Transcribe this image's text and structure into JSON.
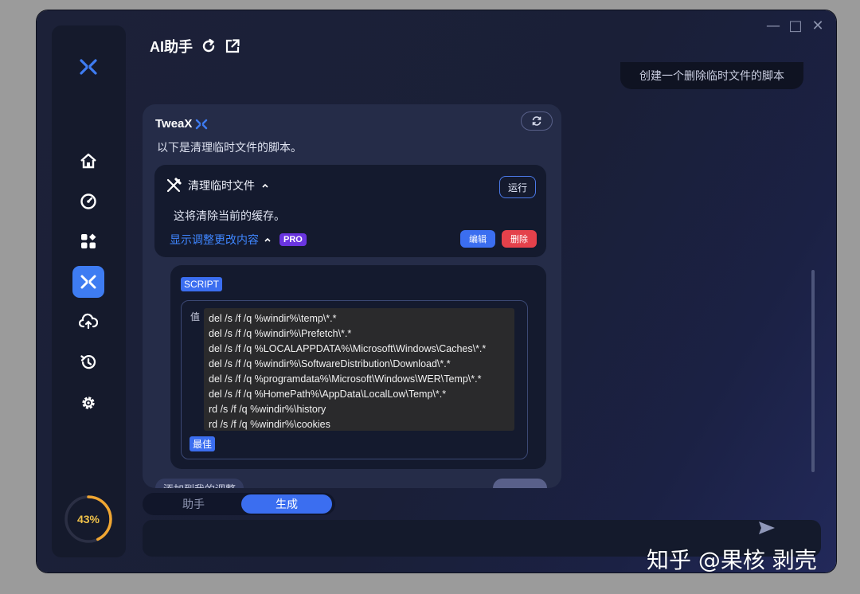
{
  "app": {
    "title": "AI助手",
    "window_controls": [
      "—",
      "□",
      "✕"
    ]
  },
  "sidebar": {
    "logo": "x-logo-icon",
    "items": [
      {
        "name": "home",
        "icon": "home-icon",
        "active": false
      },
      {
        "name": "performance",
        "icon": "gauge-icon",
        "active": false
      },
      {
        "name": "apps",
        "icon": "apps-grid-icon",
        "active": false
      },
      {
        "name": "ai-assistant",
        "icon": "x-logo-icon",
        "active": true
      },
      {
        "name": "cloud-upload",
        "icon": "cloud-upload-icon",
        "active": false
      },
      {
        "name": "history",
        "icon": "history-icon",
        "active": false
      },
      {
        "name": "settings",
        "icon": "gear-icon",
        "active": false
      }
    ],
    "progress": {
      "percent": 43,
      "label": "43%"
    }
  },
  "chat": {
    "user_message": "创建一个删除临时文件的脚本",
    "assistant": {
      "name": "TweaX",
      "intro": "以下是清理临时文件的脚本。",
      "tweak": {
        "title": "清理临时文件",
        "run_label": "运行",
        "description": "这将清除当前的缓存。",
        "show_changes_label": "显示调整更改内容",
        "pro_badge": "PRO",
        "edit_label": "编辑",
        "delete_label": "删除"
      },
      "script": {
        "tag": "SCRIPT",
        "value_label": "值",
        "code": "del /s /f /q %windir%\\temp\\*.*\ndel /s /f /q %windir%\\Prefetch\\*.*\ndel /s /f /q %LOCALAPPDATA%\\Microsoft\\Windows\\Caches\\*.*\ndel /s /f /q %windir%\\SoftwareDistribution\\Download\\*.*\ndel /s /f /q %programdata%\\Microsoft\\Windows\\WER\\Temp\\*.*\ndel /s /f /q %HomePath%\\AppData\\LocalLow\\Temp\\*.*\nrd /s /f /q %windir%\\history\nrd /s /f /q %windir%\\cookies",
        "best_tag": "最佳"
      },
      "partial_footer_left": "添加到我的调整"
    }
  },
  "tabs": [
    {
      "label": "助手",
      "active": false
    },
    {
      "label": "生成",
      "active": true
    }
  ],
  "input": {
    "placeholder": ""
  },
  "watermark": "知乎 @果核 剥壳",
  "colors": {
    "accent": "#3b6ef0",
    "danger": "#e4414b",
    "pro": "#6a35e0",
    "progress": "#f0c24a"
  }
}
